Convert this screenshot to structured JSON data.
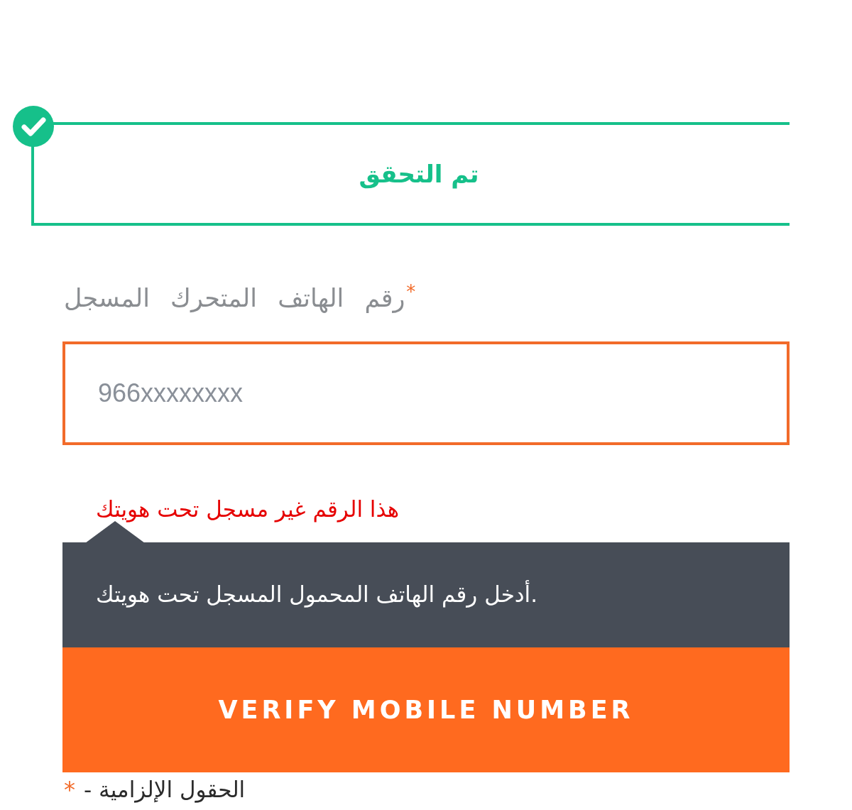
{
  "verification": {
    "verified": true,
    "label": "تم التحقق"
  },
  "phone_field": {
    "label": "رقم الهاتف المتحرك المسجل",
    "required_mark": "*",
    "placeholder": "966xxxxxxxx",
    "invalid": true,
    "error": "هذا الرقم غير مسجل تحت هويتك"
  },
  "tooltip": {
    "text": "أدخل رقم الهاتف المحمول المسجل تحت هويتك."
  },
  "submit_button": {
    "label": "VERIFY MOBILE NUMBER"
  },
  "footnote": {
    "required_mark": "*",
    "text": "- الحقول الإلزامية"
  }
}
